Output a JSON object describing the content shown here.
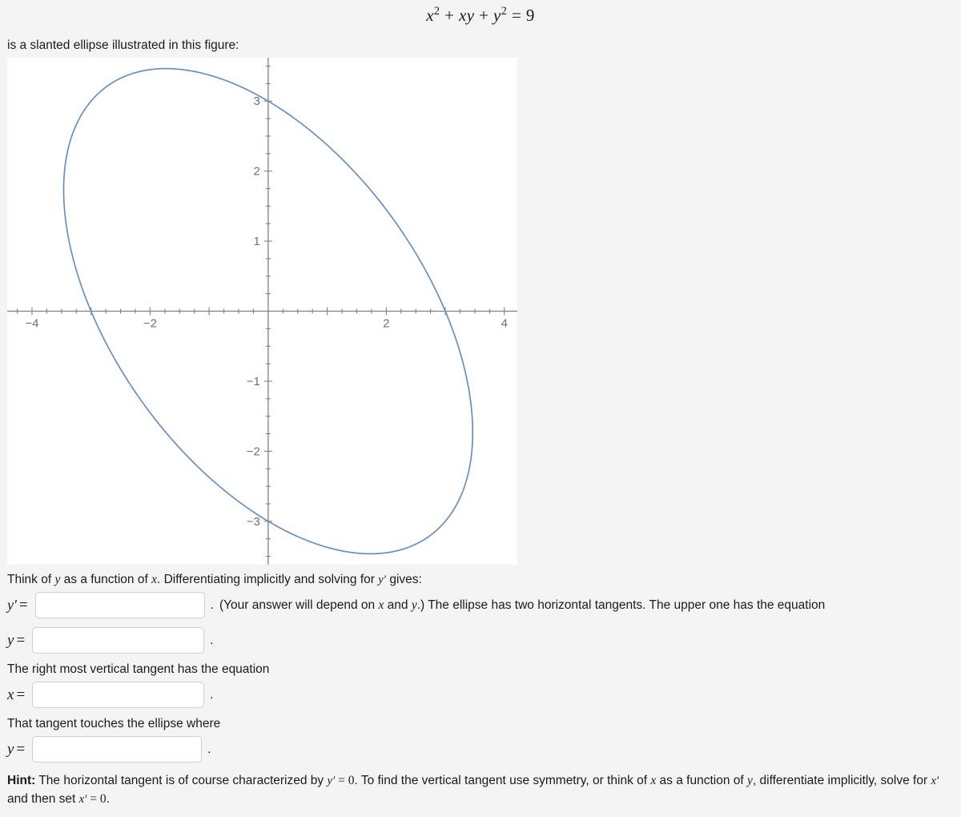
{
  "equation_header": {
    "var_x": "x",
    "exp2_a": "2",
    "plus1": "+",
    "xy": "xy",
    "plus2": "+",
    "var_y": "y",
    "exp2_b": "2",
    "equals": "=",
    "rhs": "9"
  },
  "intro": {
    "text": "is a slanted ellipse illustrated in this figure:"
  },
  "chart_data": {
    "type": "line",
    "title": "",
    "xlabel": "",
    "ylabel": "",
    "curve_label": "x^2 + xy + y^2 = 9",
    "xlim": [
      -4.42,
      4.22
    ],
    "ylim": [
      -3.62,
      3.62
    ],
    "xticks_major": [
      -4,
      -2,
      2,
      4
    ],
    "xtick_labels": [
      "−4",
      "−2",
      "2",
      "4"
    ],
    "yticks_major": [
      -3,
      -2,
      -1,
      1,
      2,
      3
    ],
    "ytick_labels": [
      "−3",
      "−2",
      "−1",
      "1",
      "2",
      "3"
    ],
    "minor_tick_step": 0.25,
    "grid": false,
    "legend": "none",
    "curve_color": "#6c8ebf",
    "axis_color": "#808080",
    "tick_label_color": "#707070",
    "plot_background": "#ffffff",
    "semi_major_axis": 4.2426,
    "semi_minor_axis": 2.4495,
    "rotation_degrees": 135,
    "extremes": {
      "top_vertex": [
        -1.732,
        3.464
      ],
      "bottom_vertex": [
        1.732,
        -3.464
      ],
      "right_vertex": [
        3.464,
        -1.732
      ],
      "left_vertex": [
        -3.464,
        1.732
      ]
    }
  },
  "work": {
    "line1_part1": "Think of ",
    "line1_y": "y",
    "line1_part2": " as a function of ",
    "line1_x": "x",
    "line1_part3": ". Differentiating implicitly and solving for ",
    "line1_yprime": "y′",
    "line1_part4": " gives:",
    "yprime_label_var": "y′",
    "yprime_label_eq": "=",
    "yprime_value": "",
    "yprime_placeholder": "",
    "period1": ".",
    "after_yprime_1": "(Your answer will depend on ",
    "after_yprime_x": "x",
    "after_yprime_2": " and ",
    "after_yprime_y": "y",
    "after_yprime_3": ".) The ellipse has two horizontal tangents. The upper one has the equation",
    "y_label_var": "y",
    "y_label_eq": "=",
    "y_value": "",
    "y_placeholder": "",
    "period2": ".",
    "line_vertical": "The right most vertical tangent has the equation",
    "x_label_var": "x",
    "x_label_eq": "=",
    "x_value": "",
    "x_placeholder": "",
    "period3": ".",
    "line_touches": "That tangent touches the ellipse where",
    "y2_label_var": "y",
    "y2_label_eq": "=",
    "y2_value": "",
    "y2_placeholder": "",
    "period4": "."
  },
  "hint": {
    "label": "Hint:",
    "part1": " The horizontal tangent is of course characterized by ",
    "yprime": "y′",
    "eq1": " = ",
    "zero1": "0",
    "part2": ". To find the vertical tangent use symmetry, or think of ",
    "x_var": "x",
    "part3": " as a function of ",
    "y_var": "y",
    "part4": ", differentiate implicitly, solve for ",
    "xprime": "x′",
    "part5": " and then set ",
    "xprime2": "x′",
    "eq2": " = ",
    "zero2": "0",
    "period": "."
  }
}
